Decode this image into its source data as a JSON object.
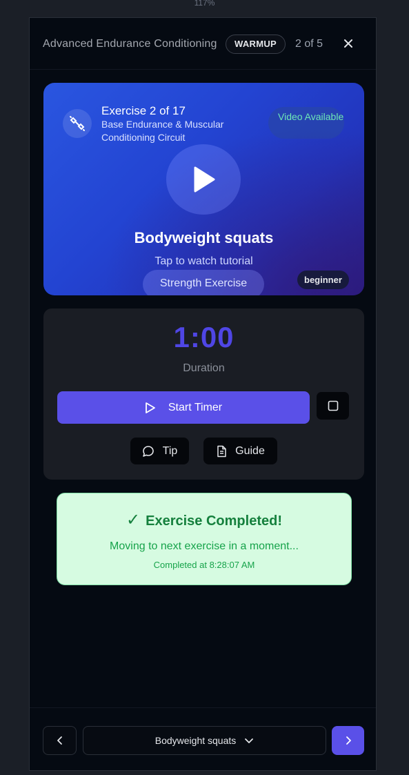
{
  "zoom_level": "117%",
  "header": {
    "title": "Advanced Endurance Conditioning",
    "phase_badge": "WARMUP",
    "step_counter": "2 of 5",
    "close_icon": "close-icon"
  },
  "video_card": {
    "exercise_counter": "Exercise 2 of 17",
    "circuit_name": "Base Endurance & Muscular Conditioning Circuit",
    "video_badge": "Video Available",
    "exercise_name": "Bodyweight squats",
    "tap_hint": "Tap to watch tutorial",
    "category": "Strength Exercise",
    "level": "beginner",
    "icons": [
      "dumbbell-icon",
      "play-icon"
    ]
  },
  "timer": {
    "value": "1:00",
    "label": "Duration",
    "start_label": "Start Timer",
    "tip_label": "Tip",
    "guide_label": "Guide",
    "icons": [
      "play-outline-icon",
      "square-icon",
      "message-circle-icon",
      "document-icon"
    ]
  },
  "completed": {
    "title": "Exercise Completed!",
    "message": "Moving to next exercise in a moment...",
    "timestamp": "Completed at 8:28:07 AM"
  },
  "footer": {
    "current_exercise": "Bodyweight squats",
    "icons": [
      "chevron-left-icon",
      "chevron-down-icon",
      "chevron-right-icon"
    ]
  },
  "colors": {
    "accent": "#5a50e8",
    "timer_value": "#4f46e5",
    "success_bg": "#d6fbe1",
    "success_text": "#15803d",
    "video_badge_text": "#6ee7b7"
  }
}
